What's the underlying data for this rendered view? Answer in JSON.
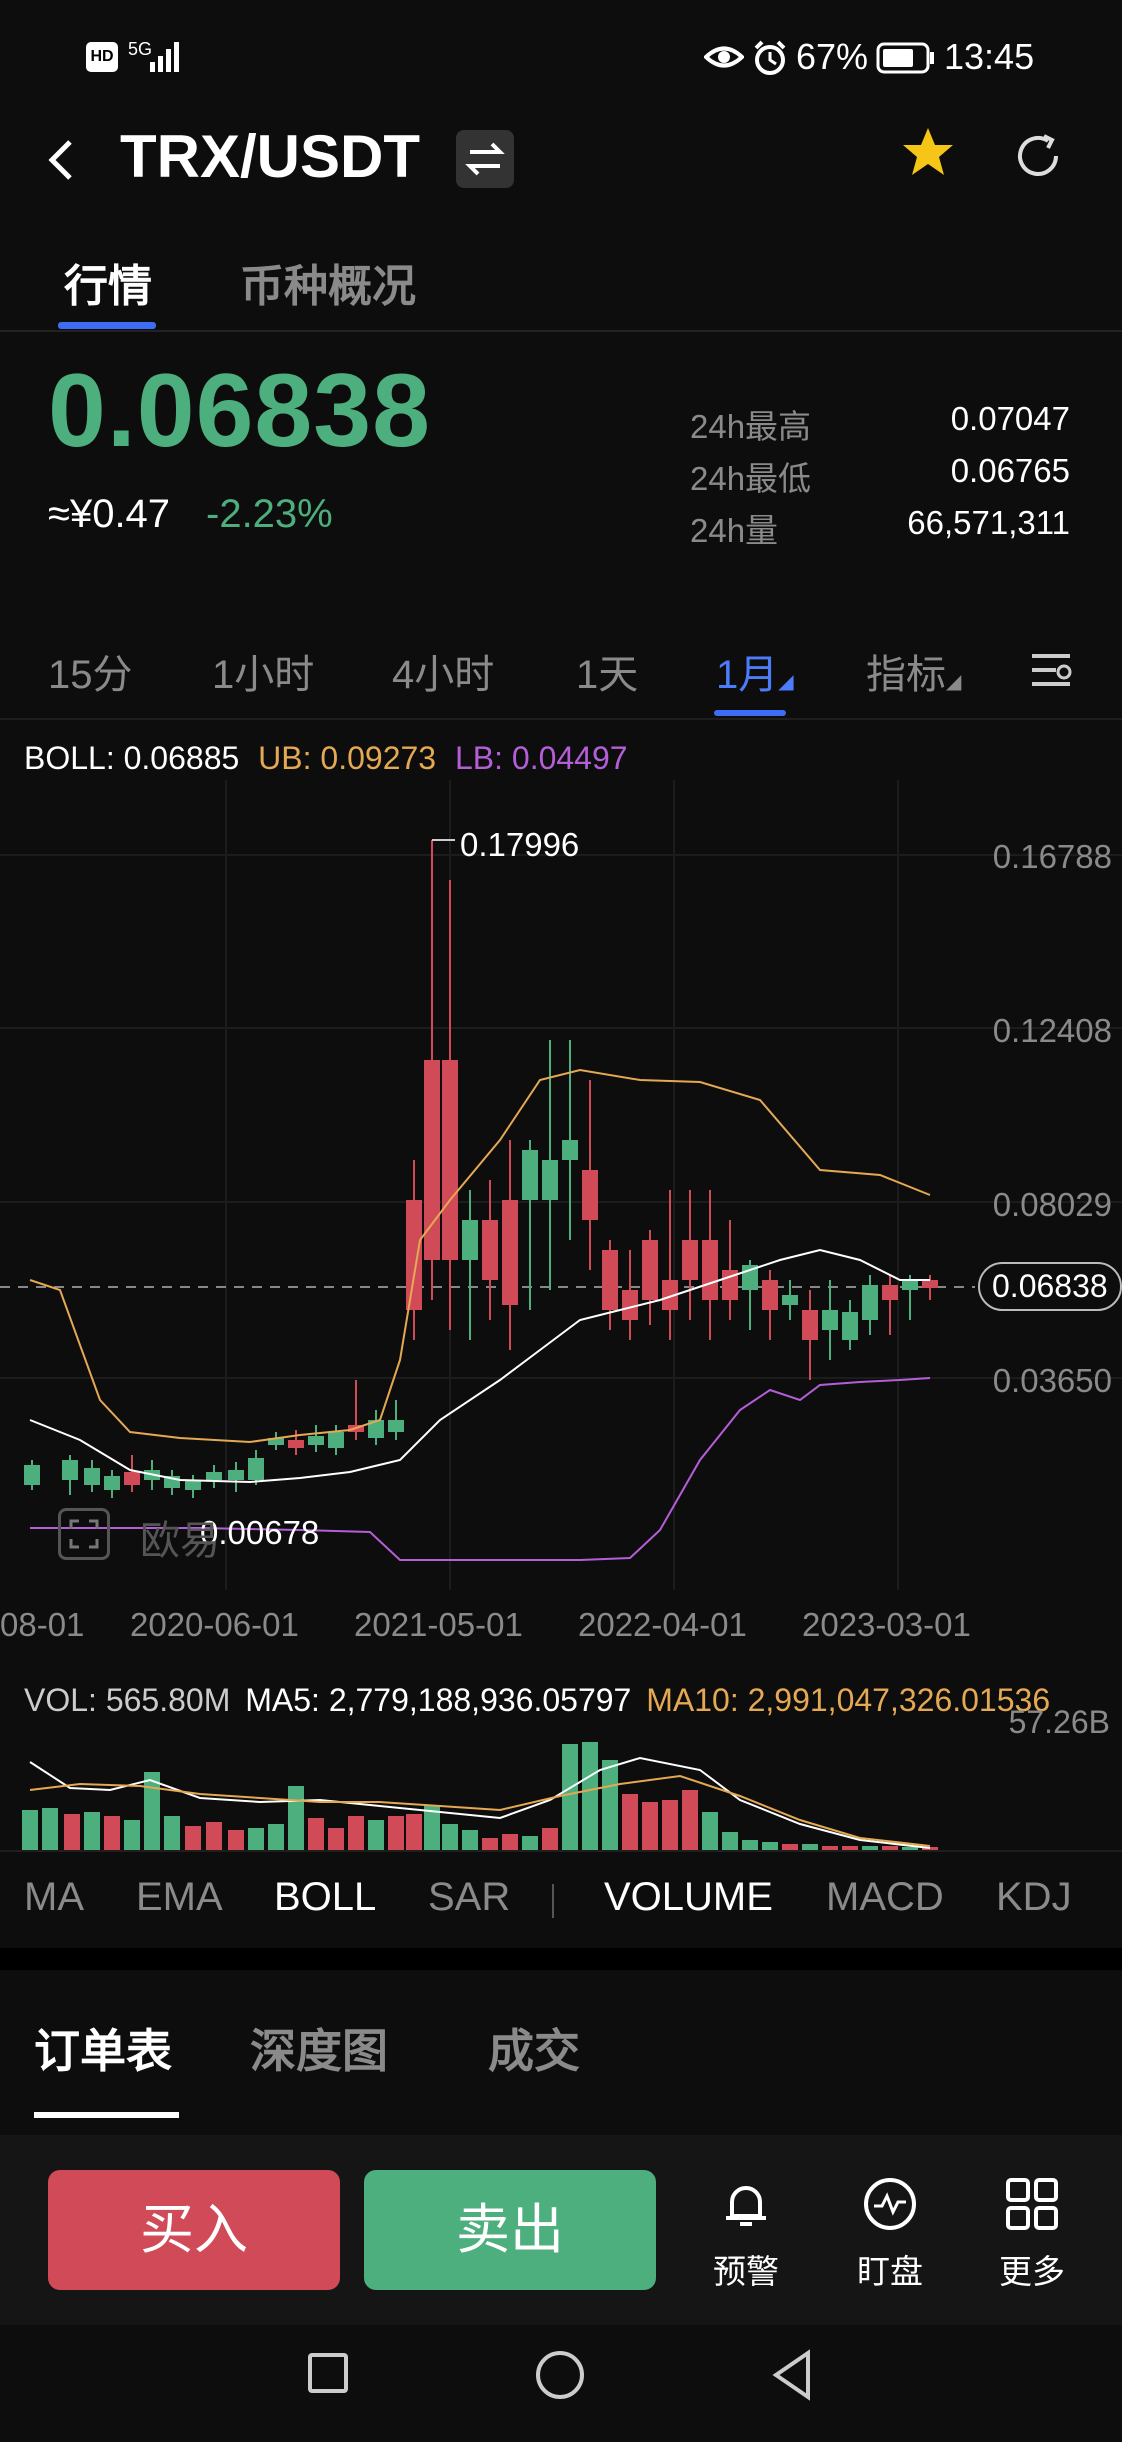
{
  "status_bar": {
    "hd": "HD",
    "network": "5G",
    "battery_pct": "67%",
    "time": "13:45"
  },
  "header": {
    "pair": "TRX/USDT"
  },
  "tabs": [
    "行情",
    "币种概况"
  ],
  "ticker": {
    "price": "0.06838",
    "cny": "≈¥0.47",
    "change": "-2.23%",
    "stats": [
      {
        "label": "24h最高",
        "value": "0.07047"
      },
      {
        "label": "24h最低",
        "value": "0.06765"
      },
      {
        "label": "24h量",
        "value": "66,571,311"
      }
    ]
  },
  "timeframes": [
    "15分",
    "1小时",
    "4小时",
    "1天",
    "1月",
    "指标"
  ],
  "boll": {
    "main": "BOLL: 0.06885",
    "ub": "UB: 0.09273",
    "lb": "LB: 0.04497"
  },
  "chart": {
    "y_labels": [
      "0.16788",
      "0.12408",
      "0.08029",
      "0.03650"
    ],
    "current_price_tag": "0.06838",
    "high_label": "0.17996",
    "low_label": "0.00678",
    "x_labels": [
      "08-01",
      "2020-06-01",
      "2021-05-01",
      "2022-04-01",
      "2023-03-01"
    ],
    "watermark": "欧易",
    "colors": {
      "up": "#4caf7d",
      "down": "#d04b57",
      "ub": "#e5a853",
      "lb": "#b45ed8",
      "mid": "#ffffff"
    }
  },
  "volume": {
    "vol": "VOL: 565.80M",
    "ma5": "MA5: 2,779,188,936.05797",
    "ma10": "MA10: 2,991,047,326.01536",
    "max_label": "57.26B"
  },
  "indicators": [
    "MA",
    "EMA",
    "BOLL",
    "SAR",
    "VOLUME",
    "MACD",
    "KDJ"
  ],
  "orderbook_tabs": [
    "订单表",
    "深度图",
    "成交"
  ],
  "actions": {
    "buy": "买入",
    "sell": "卖出",
    "alert": "预警",
    "watch": "盯盘",
    "more": "更多"
  }
}
